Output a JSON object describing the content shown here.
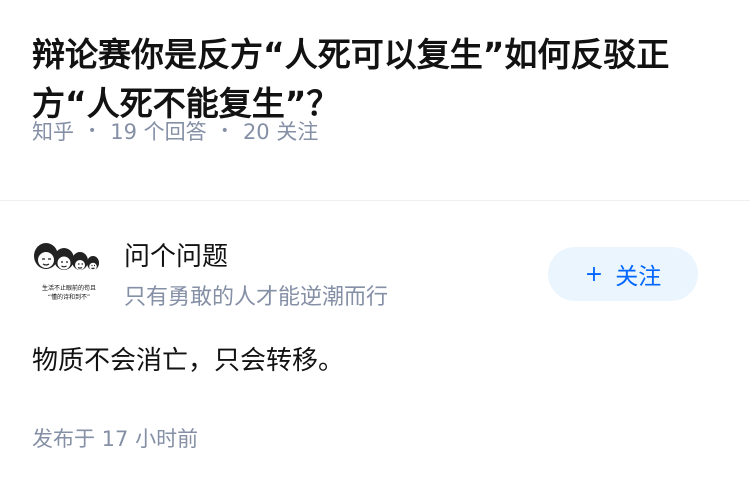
{
  "question": {
    "title": "辩论赛你是反方“人死可以复生”如何反驳正方“人死不能复生”？",
    "source": "知乎",
    "answers": "19 个回答",
    "followers": "20 关注"
  },
  "answer": {
    "author_name": "问个问题",
    "author_bio": "只有勇敢的人才能逆潮而行",
    "avatar_caption_line1": "生活不止眼前的苟且",
    "avatar_caption_line2": "“懂的诗和到不”",
    "follow_label": "关注",
    "follow_plus": "+",
    "content": "物质不会消亡，只会转移。",
    "time": "发布于 17 小时前"
  },
  "colors": {
    "meta_gray": "#8590a6",
    "follow_bg": "#ebf5fd",
    "follow_text": "#0066ff"
  }
}
